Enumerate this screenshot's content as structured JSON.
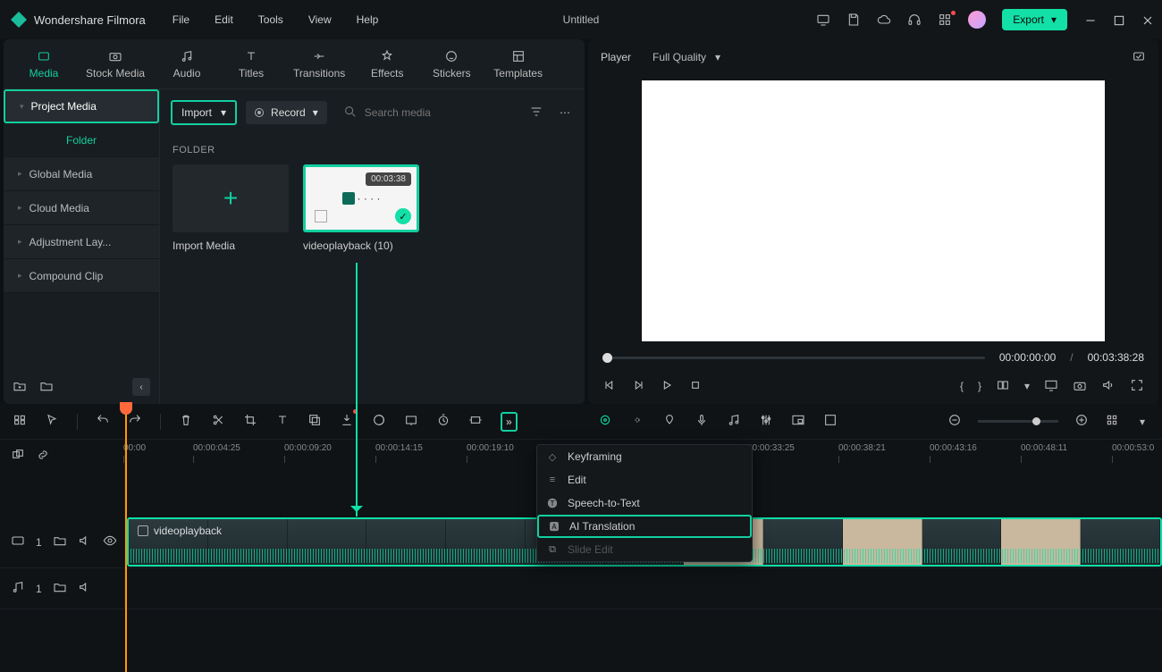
{
  "app": {
    "name": "Wondershare Filmora",
    "document": "Untitled"
  },
  "menu": [
    "File",
    "Edit",
    "Tools",
    "View",
    "Help"
  ],
  "export_label": "Export",
  "tabs": [
    {
      "label": "Media",
      "active": true
    },
    {
      "label": "Stock Media"
    },
    {
      "label": "Audio"
    },
    {
      "label": "Titles"
    },
    {
      "label": "Transitions"
    },
    {
      "label": "Effects"
    },
    {
      "label": "Stickers"
    },
    {
      "label": "Templates"
    }
  ],
  "sidebar": {
    "project": "Project Media",
    "folder": "Folder",
    "items": [
      "Global Media",
      "Cloud Media",
      "Adjustment Lay...",
      "Compound Clip"
    ]
  },
  "toolbar": {
    "import": "Import",
    "record": "Record",
    "search_placeholder": "Search media"
  },
  "folder_label": "FOLDER",
  "thumbs": {
    "import": "Import Media",
    "clip_name": "videoplayback (10)",
    "clip_dur": "00:03:38"
  },
  "player": {
    "label": "Player",
    "quality": "Full Quality",
    "current": "00:00:00:00",
    "total": "00:03:38:28"
  },
  "ruler": [
    "00:00",
    "00:00:04:25",
    "00:00:09:20",
    "00:00:14:15",
    "00:00:19:10",
    "00:00:33:25",
    "00:00:38:21",
    "00:00:43:16",
    "00:00:48:11",
    "00:00:53:0"
  ],
  "ctx": {
    "items": [
      {
        "label": "Keyframing"
      },
      {
        "label": "Edit"
      },
      {
        "label": "Speech-to-Text"
      },
      {
        "label": "AI Translation",
        "hl": true
      },
      {
        "label": "Slide Edit",
        "dis": true
      }
    ]
  },
  "clip_label": "videoplayback"
}
